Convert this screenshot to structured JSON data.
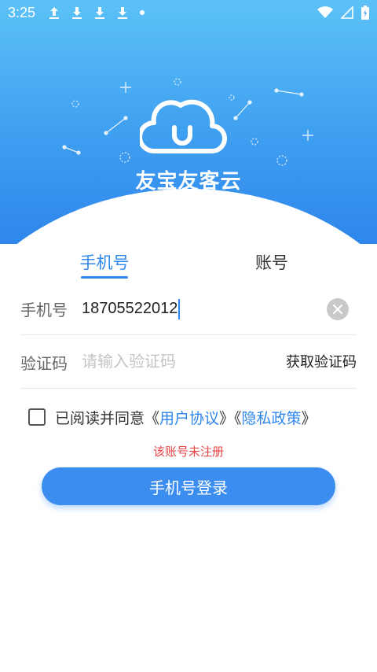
{
  "status_bar": {
    "time": "3:25",
    "icons": [
      "upload-icon",
      "download-icon",
      "download-icon",
      "download-icon",
      "dot-icon"
    ],
    "right_icons": [
      "wifi-icon",
      "signal-icon",
      "battery-icon"
    ]
  },
  "brand": {
    "title": "友宝友客云",
    "logo_icon": "cloud-icon"
  },
  "tabs": [
    {
      "label": "手机号",
      "active": true
    },
    {
      "label": "账号",
      "active": false
    }
  ],
  "phone_field": {
    "label": "手机号",
    "value": "18705522012"
  },
  "code_field": {
    "label": "验证码",
    "placeholder": "请输入验证码",
    "get_code_label": "获取验证码"
  },
  "agreement": {
    "prefix": "已阅读并同意《",
    "user_agreement": "用户协议",
    "middle": "》《",
    "privacy_policy": "隐私政策",
    "suffix": "》",
    "checked": false
  },
  "error_message": "该账号未注册",
  "login_button": "手机号登录",
  "colors": {
    "primary": "#2f86ec",
    "error": "#e84545",
    "hero_top": "#5cc2f7",
    "hero_bottom": "#2f86ec"
  }
}
